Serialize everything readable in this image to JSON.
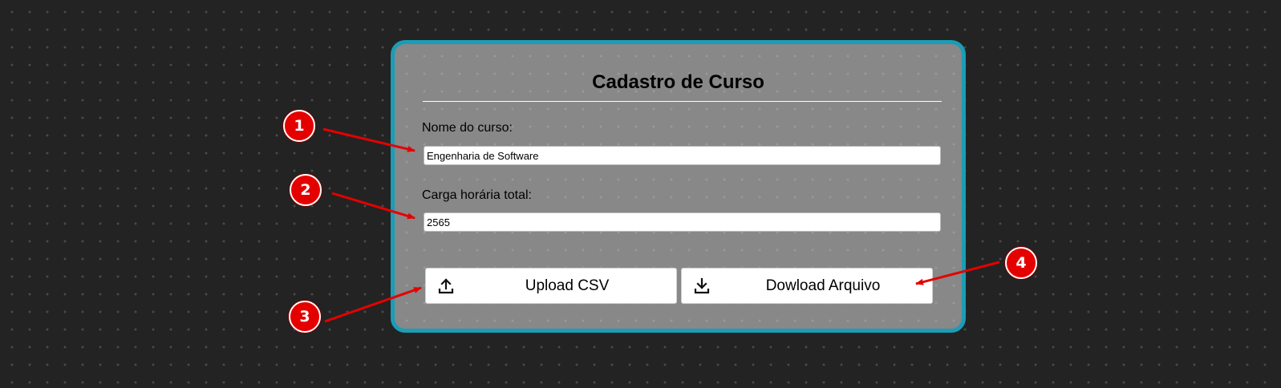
{
  "form": {
    "title": "Cadastro de Curso",
    "course_name_label": "Nome do curso:",
    "course_name_value": "Engenharia de Software",
    "workload_label": "Carga horária total:",
    "workload_value": "2565",
    "upload_button": {
      "label": "Upload CSV",
      "icon": "upload-icon"
    },
    "download_button": {
      "label": "Dowload Arquivo",
      "icon": "download-icon"
    }
  },
  "annotations": {
    "markers": [
      "1",
      "2",
      "3",
      "4"
    ],
    "marker_color": "#e50000",
    "arrow_color": "#e50000"
  },
  "colors": {
    "page_background": "#232323",
    "card_background": "#888888",
    "card_border": "#1a9db6"
  }
}
